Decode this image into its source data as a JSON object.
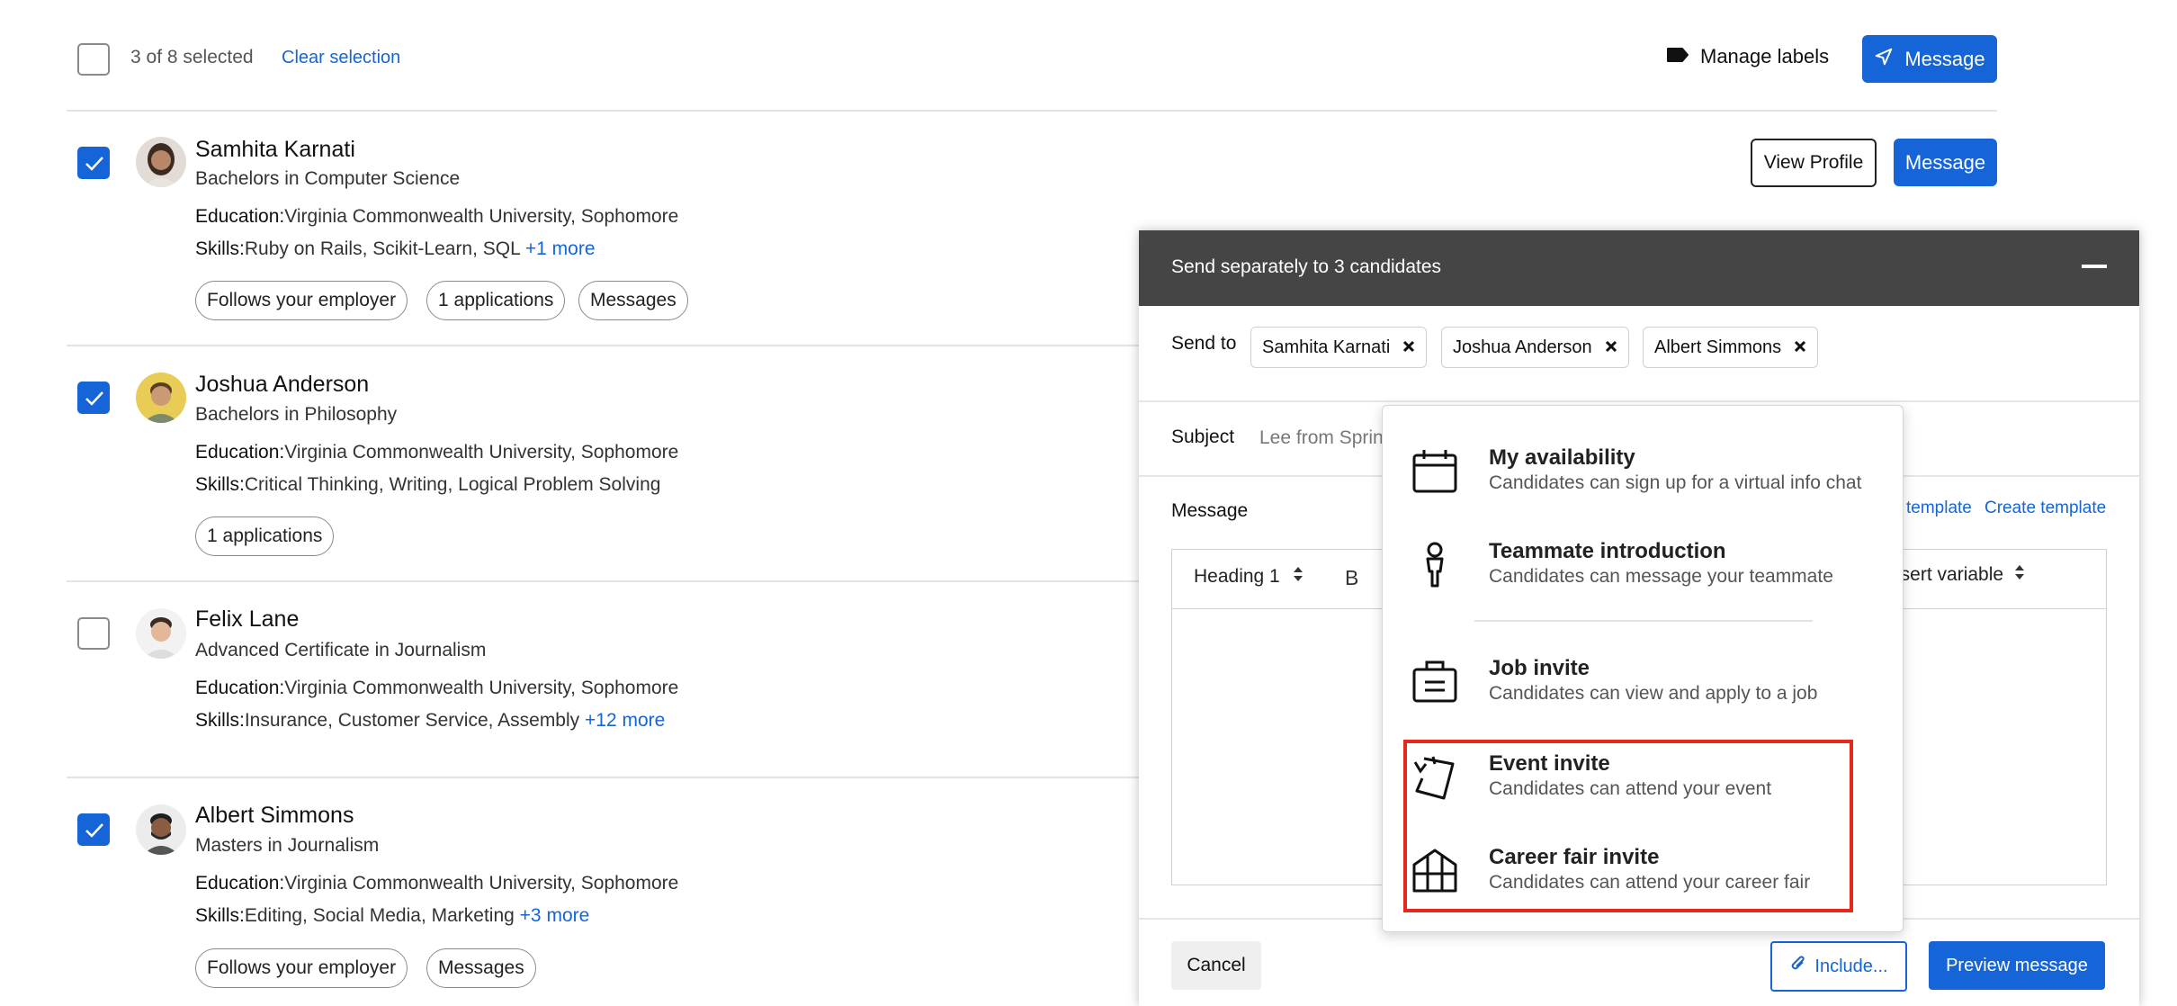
{
  "topbar": {
    "selection_count": "3 of 8 selected",
    "clear_selection": "Clear selection",
    "manage_labels": "Manage labels",
    "message_button": "Message"
  },
  "candidates": [
    {
      "name": "Samhita Karnati",
      "degree": "Bachelors in Computer Science",
      "education_label": "Education:",
      "education": "Virginia Commonwealth University, Sophomore",
      "skills_label": "Skills:",
      "skills": "Ruby on Rails, Scikit-Learn, SQL",
      "skills_more": "+1 more",
      "chips": [
        "Follows your employer",
        "1 applications",
        "Messages"
      ],
      "selected": true,
      "view_profile": "View Profile",
      "message": "Message"
    },
    {
      "name": "Joshua Anderson",
      "degree": "Bachelors in Philosophy",
      "education_label": "Education:",
      "education": "Virginia Commonwealth University, Sophomore",
      "skills_label": "Skills:",
      "skills": "Critical Thinking, Writing, Logical Problem Solving",
      "skills_more": "",
      "chips": [
        "1 applications"
      ],
      "selected": true
    },
    {
      "name": "Felix Lane",
      "degree": "Advanced Certificate in Journalism",
      "education_label": "Education:",
      "education": "Virginia Commonwealth University, Sophomore",
      "skills_label": "Skills:",
      "skills": "Insurance, Customer Service, Assembly",
      "skills_more": "+12 more",
      "chips": [],
      "selected": false
    },
    {
      "name": "Albert Simmons",
      "degree": "Masters in Journalism",
      "education_label": "Education:",
      "education": "Virginia Commonwealth University, Sophomore",
      "skills_label": "Skills:",
      "skills": "Editing, Social Media, Marketing",
      "skills_more": "+3 more",
      "chips": [
        "Follows your employer",
        "Messages"
      ],
      "selected": true
    }
  ],
  "compose": {
    "title": "Send separately to 3 candidates",
    "send_to_label": "Send to",
    "recipients": [
      "Samhita Karnati",
      "Joshua Anderson",
      "Albert Simmons"
    ],
    "subject_label": "Subject",
    "subject_value": "Lee from Sprin",
    "message_label": "Message",
    "use_template": "template",
    "create_template": "Create template",
    "heading_select": "Heading 1",
    "bold": "B",
    "insert_variable": "nsert variable",
    "cancel": "Cancel",
    "include": "Include...",
    "preview": "Preview message"
  },
  "include_menu": {
    "items": [
      {
        "title": "My availability",
        "desc": "Candidates can sign up for a virtual info chat",
        "icon": "calendar-icon"
      },
      {
        "title": "Teammate introduction",
        "desc": "Candidates can message your teammate",
        "icon": "person-icon"
      },
      {
        "title": "Job invite",
        "desc": "Candidates can view and apply to a job",
        "icon": "briefcase-icon"
      },
      {
        "title": "Event invite",
        "desc": "Candidates can attend your event",
        "icon": "ticket-icon"
      },
      {
        "title": "Career fair invite",
        "desc": "Candidates can attend your career fair",
        "icon": "booth-icon"
      }
    ]
  },
  "colors": {
    "accent": "#1565d8",
    "header_bg": "#454545",
    "highlight": "#e5271c"
  }
}
